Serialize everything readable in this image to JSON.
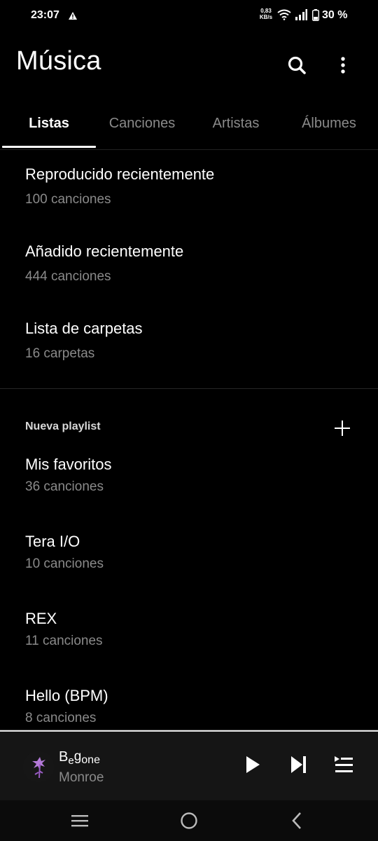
{
  "status_bar": {
    "time": "23:07",
    "speed_value": "0,83",
    "speed_unit": "KB/s",
    "battery": "30 %"
  },
  "header": {
    "title": "Música",
    "search_icon": "search-icon",
    "more_icon": "more-vert-icon"
  },
  "tabs": [
    {
      "label": "Listas",
      "active": true
    },
    {
      "label": "Canciones",
      "active": false
    },
    {
      "label": "Artistas",
      "active": false
    },
    {
      "label": "Álbumes",
      "active": false
    }
  ],
  "smart_lists": [
    {
      "name": "Reproducido recientemente",
      "meta": "100 canciones"
    },
    {
      "name": "Añadido recientemente",
      "meta": "444 canciones"
    },
    {
      "name": "Lista de carpetas",
      "meta": "16 carpetas"
    }
  ],
  "playlists_section": {
    "label": "Nueva playlist",
    "add_icon": "plus-icon"
  },
  "playlists": [
    {
      "name": "Mis favoritos",
      "meta": "36 canciones"
    },
    {
      "name": "Tera I/O",
      "meta": "10 canciones"
    },
    {
      "name": "REX",
      "meta": "11 canciones"
    },
    {
      "name": "Hello (BPM)",
      "meta": "8 canciones"
    }
  ],
  "mini_player": {
    "title_parts": [
      "B",
      "e",
      "g",
      "one"
    ],
    "artist": "Monroe",
    "play_icon": "play-icon",
    "next_icon": "skip-next-icon",
    "queue_icon": "queue-icon"
  },
  "colors": {
    "background": "#000000",
    "secondary_text": "#8a8a8a",
    "mini_player_bg": "#151515"
  }
}
